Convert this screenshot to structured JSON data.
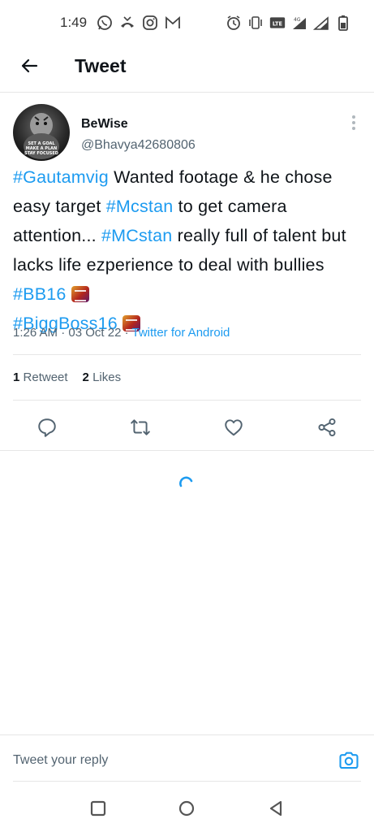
{
  "status_bar": {
    "time": "1:49",
    "left_icons": [
      "whatsapp-icon",
      "missed-call-icon",
      "instagram-icon",
      "gmail-icon"
    ],
    "right_icons": [
      "alarm-icon",
      "vibrate-icon",
      "volte-icon",
      "signal-4g-icon",
      "signal-icon",
      "battery-icon"
    ],
    "network": "4G"
  },
  "app_bar": {
    "title": "Tweet",
    "back_icon": "back-arrow-icon"
  },
  "tweet": {
    "author_name": "BeWise",
    "author_handle": "@Bhavya42680806",
    "avatar_text": "SET A GOAL MAKE A PLAN STAY FOCUSED",
    "body": {
      "tag1": "#Gautamvig",
      "text1": " Wanted footage & he chose easy target ",
      "tag2": "#Mcstan",
      "text2": " to get camera attention... ",
      "tag3": "#MCstan",
      "text3": " really full of talent but lacks life ezperience to deal with bullies ",
      "tag4": "#BB16",
      "tag5": "#BiggBoss16"
    },
    "time": "1:26 AM",
    "date": "03 Oct 22",
    "source": "Twitter for Android",
    "retweets_count": "1",
    "retweets_label": "Retweet",
    "likes_count": "2",
    "likes_label": "Likes"
  },
  "actions": [
    "reply-icon",
    "retweet-icon",
    "like-icon",
    "share-icon"
  ],
  "reply_bar": {
    "placeholder": "Tweet your reply"
  },
  "colors": {
    "accent": "#1d9bf0",
    "text": "#0f1419",
    "secondary": "#536471"
  }
}
